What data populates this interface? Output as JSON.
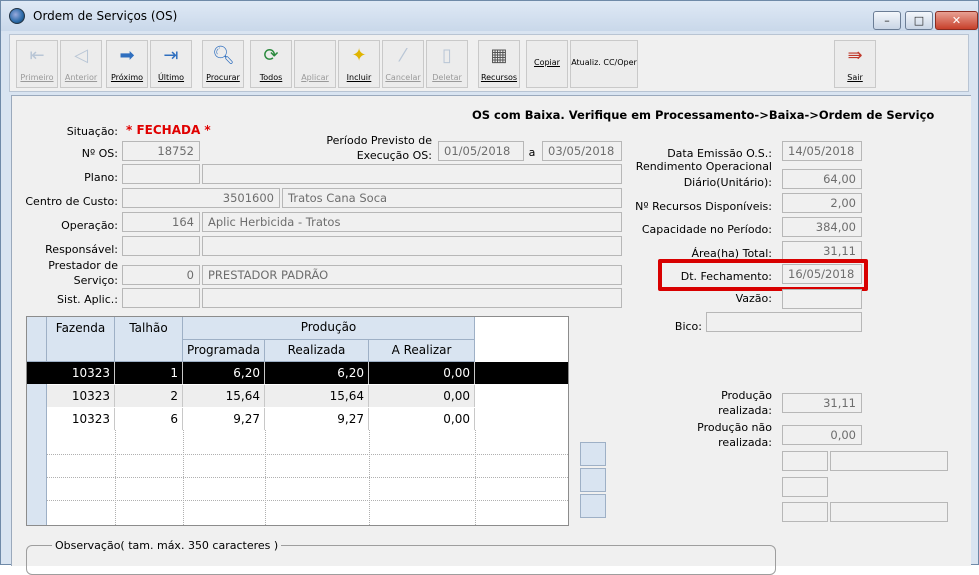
{
  "window": {
    "title": "Ordem de Serviços (OS)",
    "minimize": "–",
    "maximize": "□",
    "close": "✕"
  },
  "toolbar": {
    "primeiro": "Primeiro",
    "anterior": "Anterior",
    "proximo": "Próximo",
    "ultimo": "Último",
    "procurar": "Procurar",
    "todos": "Todos",
    "aplicar": "Aplicar",
    "incluir": "Incluir",
    "cancelar": "Cancelar",
    "deletar": "Deletar",
    "recursos": "Recursos",
    "copiar": "Copiar",
    "atualiz": "Atualiz. CC/Oper",
    "sair": "Sair"
  },
  "banner": "OS com Baixa. Verifique em Processamento->Baixa->Ordem de Serviço",
  "form": {
    "situacao_label": "Situação:",
    "situacao_value": "* FECHADA *",
    "nos_label": "Nº OS:",
    "nos_value": "18752",
    "periodo_label_1": "Período Previsto de",
    "periodo_label_2": "Execução OS:",
    "periodo_inicio": "01/05/2018",
    "periodo_a": "a",
    "periodo_fim": "03/05/2018",
    "plano_label": "Plano:",
    "centro_label": "Centro de Custo:",
    "centro_codigo": "3501600",
    "centro_nome": "Tratos Cana Soca",
    "operacao_label": "Operação:",
    "operacao_codigo": "164",
    "operacao_nome": "Aplic Herbicida - Tratos",
    "responsavel_label": "Responsável:",
    "prestador_label_1": "Prestador de",
    "prestador_label_2": "Serviço:",
    "prestador_codigo": "0",
    "prestador_nome": "PRESTADOR PADRÃO",
    "sist_label": "Sist. Aplic.:"
  },
  "right": {
    "emissao_label": "Data Emissão O.S.:",
    "emissao_value": "14/05/2018",
    "rend_label_1": "Rendimento Operacional",
    "rend_label_2": "Diário(Unitário):",
    "rend_value": "64,00",
    "recursos_label": "Nº Recursos Disponíveis:",
    "recursos_value": "2,00",
    "capacidade_label": "Capacidade no Período:",
    "capacidade_value": "384,00",
    "area_label": "Área(ha) Total:",
    "area_value": "31,11",
    "fechamento_label": "Dt. Fechamento:",
    "fechamento_value": "16/05/2018",
    "vazao_label": "Vazão:",
    "bico_label": "Bico:",
    "prod_real_label_1": "Produção",
    "prod_real_label_2": "realizada:",
    "prod_real_value": "31,11",
    "prod_nreal_label_1": "Produção não",
    "prod_nreal_label_2": "realizada:",
    "prod_nreal_value": "0,00"
  },
  "grid": {
    "headers": {
      "fazenda": "Fazenda",
      "talhao": "Talhão",
      "producao": "Produção",
      "programada": "Programada",
      "realizada": "Realizada",
      "a_realizar": "A Realizar"
    },
    "rows": [
      {
        "fazenda": "10323",
        "talhao": "1",
        "programada": "6,20",
        "realizada": "6,20",
        "a_realizar": "0,00"
      },
      {
        "fazenda": "10323",
        "talhao": "2",
        "programada": "15,64",
        "realizada": "15,64",
        "a_realizar": "0,00"
      },
      {
        "fazenda": "10323",
        "talhao": "6",
        "programada": "9,27",
        "realizada": "9,27",
        "a_realizar": "0,00"
      }
    ]
  },
  "observacao_label": "Observação( tam. máx. 350 caracteres )"
}
